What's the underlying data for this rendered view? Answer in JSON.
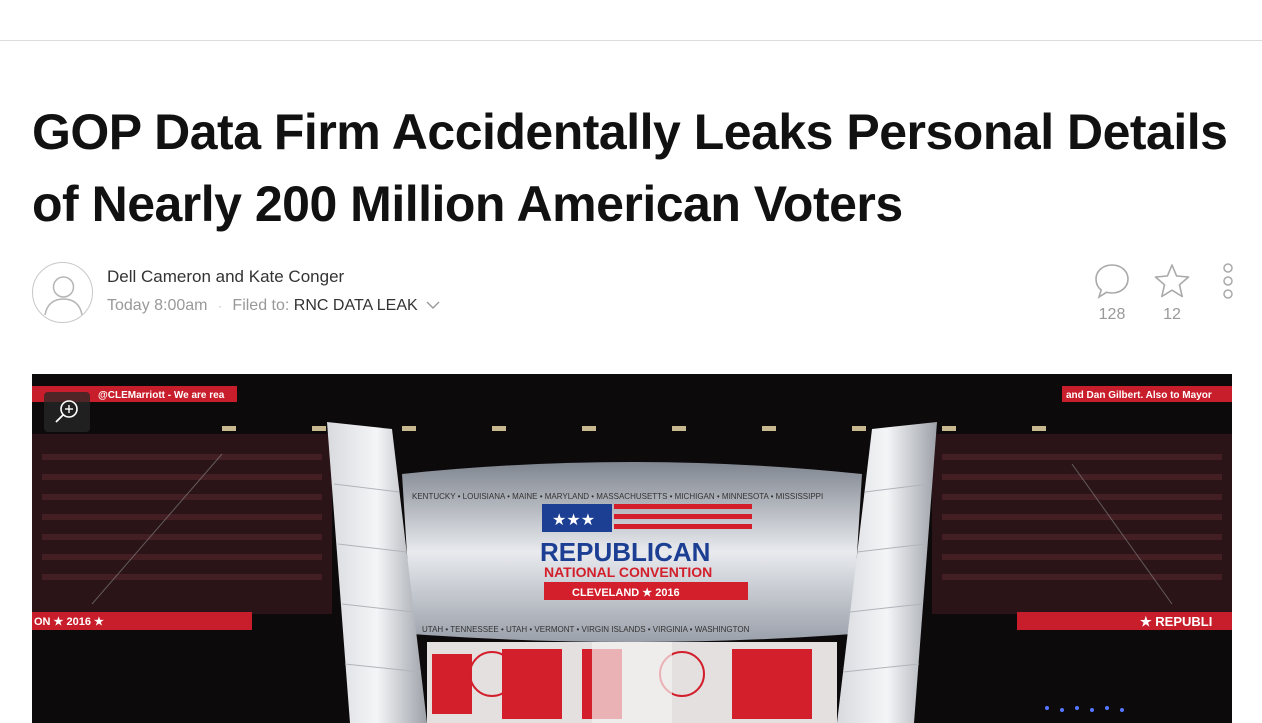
{
  "article": {
    "headline": "GOP Data Firm Accidentally Leaks Personal Details of Nearly 200 Million American Voters",
    "authors": "Dell Cameron and Kate Conger",
    "time": "Today 8:00am",
    "filed_to_label": "Filed to:",
    "tag": "RNC DATA LEAK"
  },
  "actions": {
    "comments_count": "128",
    "stars_count": "12"
  },
  "hero": {
    "left_ticker": "@CLEMarriott - We are rea",
    "right_ticker": "and Dan Gilbert. Also to Mayor",
    "stage_states_top": "KENTUCKY • LOUISIANA • MAINE • MARYLAND • MASSACHUSETTS • MICHIGAN • MINNESOTA • MISSISSIPPI",
    "stage_states_bottom": "UTAH • TENNESSEE • UTAH • VERMONT • VIRGIN ISLANDS • VIRGINIA • WASHINGTON",
    "logo_line1": "REPUBLICAN",
    "logo_line2": "NATIONAL CONVENTION",
    "logo_line3": "CLEVELAND ★ 2016",
    "banner_left": "ON ★ 2016 ★",
    "banner_right": "★ REPUBLI",
    "colors": {
      "red": "#d21f2b",
      "blue": "#1c3f94",
      "dark": "#0d0a0c"
    }
  }
}
